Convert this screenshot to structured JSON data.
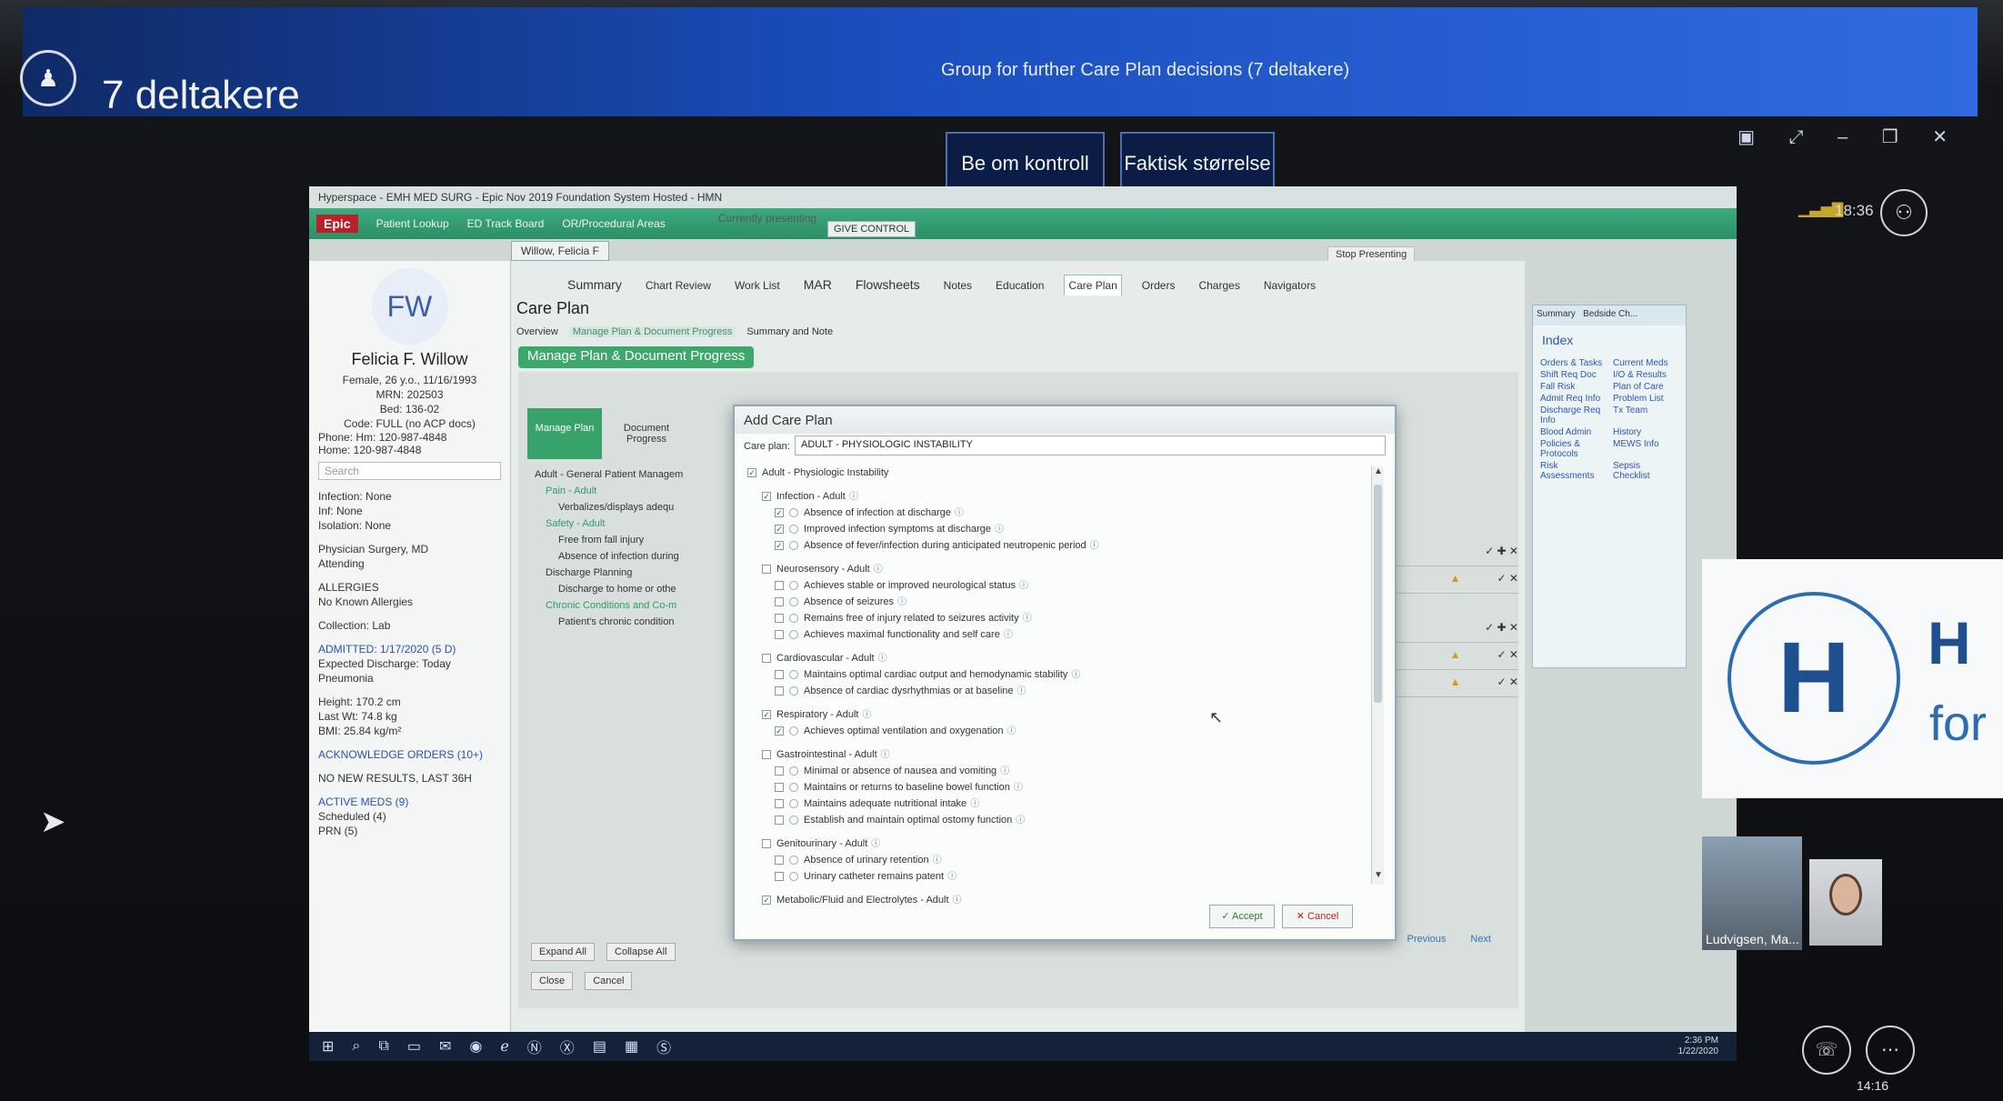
{
  "teams": {
    "window_title": "Group for further Care Plan decisions (7 deltakere)",
    "participants_label": "7 deltakere",
    "request_control_label": "Be om kontroll",
    "actual_size_label": "Faktisk størrelse",
    "clock_top": "18:36",
    "clock_bottom": "14:16"
  },
  "screen": {
    "title": "Hyperspace - EMH MED SURG - Epic Nov 2019 Foundation System Hosted - HMN",
    "presenting": "Currently presenting",
    "give_control": "GIVE CONTROL",
    "stop_presenting": "Stop Presenting",
    "toolbar": [
      "Patient Lookup",
      "ED Track Board",
      "OR/Procedural Areas"
    ],
    "epic_logo": "Epic",
    "patient_tab": "Willow, Felicia F"
  },
  "patient": {
    "initials": "FW",
    "name": "Felicia F. Willow",
    "demographics": "Female, 26 y.o., 11/16/1993",
    "mrn": "MRN: 202503",
    "bed": "Bed: 136-02",
    "code": "Code: FULL (no ACP docs)",
    "phone": "Phone: Hm: 120-987-4848",
    "home": "Home: 120-987-4848",
    "search_placeholder": "Search",
    "infection": "Infection: None",
    "inf": "Inf: None",
    "isolation": "Isolation: None",
    "physician": "Physician Surgery, MD",
    "attending": "Attending",
    "allergies_header": "ALLERGIES",
    "allergies": "No Known Allergies",
    "collection": "Collection: Lab",
    "admitted": "ADMITTED: 1/17/2020 (5 D)",
    "discharge": "Expected Discharge: Today",
    "diagnosis": "Pneumonia",
    "height": "Height: 170.2 cm",
    "weight": "Last Wt: 74.8 kg",
    "bmi": "BMI: 25.84 kg/m²",
    "ack_orders": "ACKNOWLEDGE ORDERS (10+)",
    "no_results": "NO NEW RESULTS, LAST 36H",
    "active_meds": "ACTIVE MEDS (9)",
    "scheduled": "Scheduled (4)",
    "prn": "PRN (5)"
  },
  "nav": {
    "tabs": [
      "Summary",
      "Chart Review",
      "Work List",
      "MAR",
      "Flowsheets",
      "Notes",
      "Education",
      "Care Plan",
      "Orders",
      "Charges",
      "Navigators"
    ],
    "page_title": "Care Plan",
    "subtabs": [
      "Overview",
      "Manage Plan & Document Progress",
      "Summary and Note"
    ],
    "section_header": "Manage Plan & Document Progress",
    "manage_plan": "Manage Plan",
    "document_progress": "Document Progress",
    "expand_all": "Expand All",
    "collapse_all": "Collapse All",
    "close": "Close",
    "cancel": "Cancel",
    "previous": "Previous",
    "next": "Next"
  },
  "tree": [
    "Adult - General Patient Managem",
    "Pain - Adult",
    "Verbalizes/displays adequ",
    "Safety - Adult",
    "Free from fall injury",
    "Absence of infection during",
    "Discharge Planning",
    "Discharge to home or othe",
    "Chronic Conditions and Co-m",
    "Patient's chronic condition"
  ],
  "index": {
    "tabs": [
      "Summary",
      "Bedside Ch..."
    ],
    "title": "Index",
    "items": [
      "Orders & Tasks",
      "Current Meds",
      "Shift Req Doc",
      "I/O & Results",
      "Fall Risk",
      "Plan of Care",
      "Admit Req Info",
      "Problem List",
      "Discharge Req Info",
      "Tx Team",
      "Blood Admin",
      "History",
      "Policies & Protocols",
      "MEWS Info",
      "Risk Assessments",
      "Sepsis Checklist"
    ]
  },
  "modal": {
    "title": "Add Care Plan",
    "care_plan_label": "Care plan:",
    "care_plan_value": "ADULT - PHYSIOLOGIC INSTABILITY",
    "root": "Adult - Physiologic Instability",
    "items": [
      {
        "text": "Infection - Adult",
        "level": 1,
        "checked": true
      },
      {
        "text": "Absence of infection at discharge",
        "level": 2,
        "checked": true
      },
      {
        "text": "Improved infection symptoms at discharge",
        "level": 2,
        "checked": true
      },
      {
        "text": "Absence of fever/infection during anticipated neutropenic period",
        "level": 2,
        "checked": true
      },
      {
        "text": "Neurosensory - Adult",
        "level": 1,
        "checked": false
      },
      {
        "text": "Achieves stable or improved neurological status",
        "level": 2,
        "checked": false
      },
      {
        "text": "Absence of seizures",
        "level": 2,
        "checked": false
      },
      {
        "text": "Remains free of injury related to seizures activity",
        "level": 2,
        "checked": false
      },
      {
        "text": "Achieves maximal functionality and self care",
        "level": 2,
        "checked": false
      },
      {
        "text": "Cardiovascular - Adult",
        "level": 1,
        "checked": false
      },
      {
        "text": "Maintains optimal cardiac output and hemodynamic stability",
        "level": 2,
        "checked": false
      },
      {
        "text": "Absence of cardiac dysrhythmias or at baseline",
        "level": 2,
        "checked": false
      },
      {
        "text": "Respiratory - Adult",
        "level": 1,
        "checked": true
      },
      {
        "text": "Achieves optimal ventilation and oxygenation",
        "level": 2,
        "checked": true
      },
      {
        "text": "Gastrointestinal - Adult",
        "level": 1,
        "checked": false
      },
      {
        "text": "Minimal or absence of nausea and vomiting",
        "level": 2,
        "checked": false
      },
      {
        "text": "Maintains or returns to baseline bowel function",
        "level": 2,
        "checked": false
      },
      {
        "text": "Maintains adequate nutritional intake",
        "level": 2,
        "checked": false
      },
      {
        "text": "Establish and maintain optimal ostomy function",
        "level": 2,
        "checked": false
      },
      {
        "text": "Genitourinary - Adult",
        "level": 1,
        "checked": false
      },
      {
        "text": "Absence of urinary retention",
        "level": 2,
        "checked": false
      },
      {
        "text": "Urinary catheter remains patent",
        "level": 2,
        "checked": false
      },
      {
        "text": "Metabolic/Fluid and Electrolytes - Adult",
        "level": 1,
        "checked": true
      }
    ],
    "accept": "Accept",
    "cancel": "Cancel"
  },
  "overlays": {
    "logo_letter": "H",
    "logo_text1": "H",
    "logo_text2": "for",
    "video_name": "Ludvigsen, Ma..."
  },
  "tray": {
    "time": "2:36 PM",
    "date": "1/22/2020"
  },
  "colors": {
    "teams_blue": "#1b4fc0",
    "epic_green": "#3ea76c",
    "epic_red": "#b9202a",
    "accent_link": "#2a4fb8"
  }
}
